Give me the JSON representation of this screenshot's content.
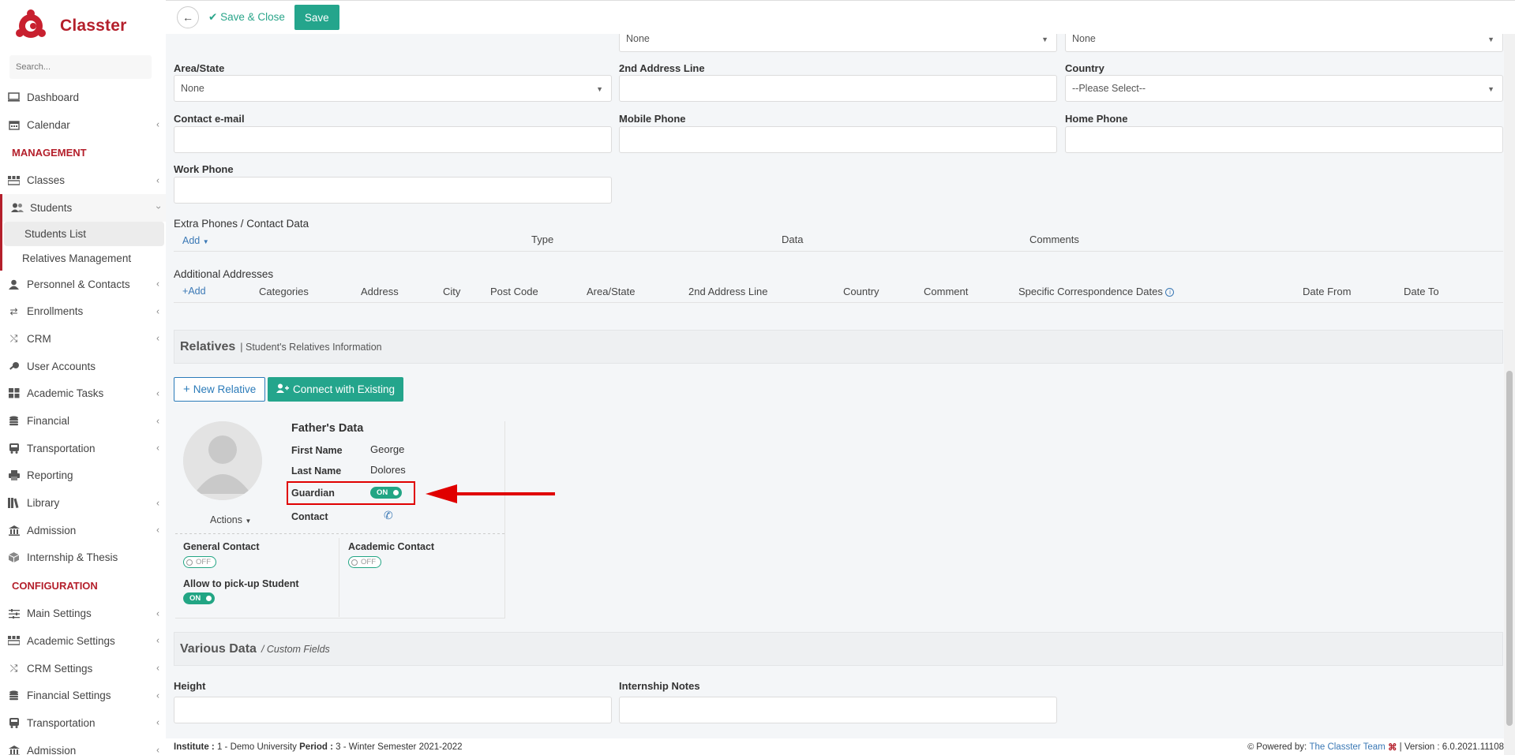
{
  "app": {
    "brand": "Classter",
    "search_placeholder": "Search..."
  },
  "sidebar": {
    "top_items": [
      {
        "label": "Dashboard"
      },
      {
        "label": "Calendar"
      }
    ],
    "sections": {
      "management": "MANAGEMENT",
      "configuration": "CONFIGURATION"
    },
    "management_items": [
      {
        "label": "Classes"
      },
      {
        "label": "Students"
      },
      {
        "label": "Personnel & Contacts"
      },
      {
        "label": "Enrollments"
      },
      {
        "label": "CRM"
      },
      {
        "label": "User Accounts"
      },
      {
        "label": "Academic Tasks"
      },
      {
        "label": "Financial"
      },
      {
        "label": "Transportation"
      },
      {
        "label": "Reporting"
      },
      {
        "label": "Library"
      },
      {
        "label": "Admission"
      },
      {
        "label": "Internship & Thesis"
      }
    ],
    "students_sub": [
      {
        "label": "Students List"
      },
      {
        "label": "Relatives Management"
      }
    ],
    "configuration_items": [
      {
        "label": "Main Settings"
      },
      {
        "label": "Academic Settings"
      },
      {
        "label": "CRM Settings"
      },
      {
        "label": "Financial Settings"
      },
      {
        "label": "Transportation"
      },
      {
        "label": "Admission"
      }
    ]
  },
  "toolbar": {
    "save_close": "Save & Close",
    "save": "Save"
  },
  "form": {
    "top_selects": [
      "None",
      "None"
    ],
    "area_state": {
      "label": "Area/State",
      "value": "None"
    },
    "address2": {
      "label": "2nd Address Line",
      "value": ""
    },
    "country": {
      "label": "Country",
      "value": "--Please Select--"
    },
    "contact_email": {
      "label": "Contact e-mail",
      "value": ""
    },
    "mobile_phone": {
      "label": "Mobile Phone",
      "value": ""
    },
    "home_phone": {
      "label": "Home Phone",
      "value": ""
    },
    "work_phone": {
      "label": "Work Phone",
      "value": ""
    }
  },
  "extra_phones": {
    "title": "Extra Phones / Contact Data",
    "add": "Add",
    "columns": [
      "Type",
      "Data",
      "Comments"
    ]
  },
  "additional_addresses": {
    "title": "Additional Addresses",
    "add": "Add",
    "columns": [
      "Categories",
      "Address",
      "City",
      "Post Code",
      "Area/State",
      "2nd Address Line",
      "Country",
      "Comment",
      "Specific Correspondence Dates",
      "Date From",
      "Date To"
    ]
  },
  "relatives": {
    "title": "Relatives",
    "subtitle": "| Student's Relatives Information",
    "new_relative": "New Relative",
    "connect_existing": "Connect with Existing",
    "card": {
      "heading": "Father's Data",
      "first_name_label": "First Name",
      "first_name": "George",
      "last_name_label": "Last Name",
      "last_name": "Dolores",
      "guardian_label": "Guardian",
      "guardian_state": "ON",
      "contact_label": "Contact",
      "actions": "Actions",
      "general_contact_label": "General Contact",
      "general_contact_state": "OFF",
      "academic_contact_label": "Academic Contact",
      "academic_contact_state": "OFF",
      "pickup_label": "Allow to pick-up Student",
      "pickup_state": "ON"
    }
  },
  "various": {
    "title": "Various Data",
    "subtitle": "/ Custom Fields",
    "height_label": "Height",
    "internship_label": "Internship Notes"
  },
  "footer": {
    "institute_label": "Institute :",
    "institute_value": "1 - Demo University",
    "period_label": "Period :",
    "period_value": "3 - Winter Semester 2021-2022",
    "powered_by": "Powered by:",
    "team": "The Classter Team",
    "version": "| Version : 6.0.2021.11108"
  },
  "colors": {
    "brand_red": "#b41f2b",
    "accent_green": "#24a58c",
    "link_blue": "#2b7bb9",
    "annotation_red": "#e00000"
  }
}
